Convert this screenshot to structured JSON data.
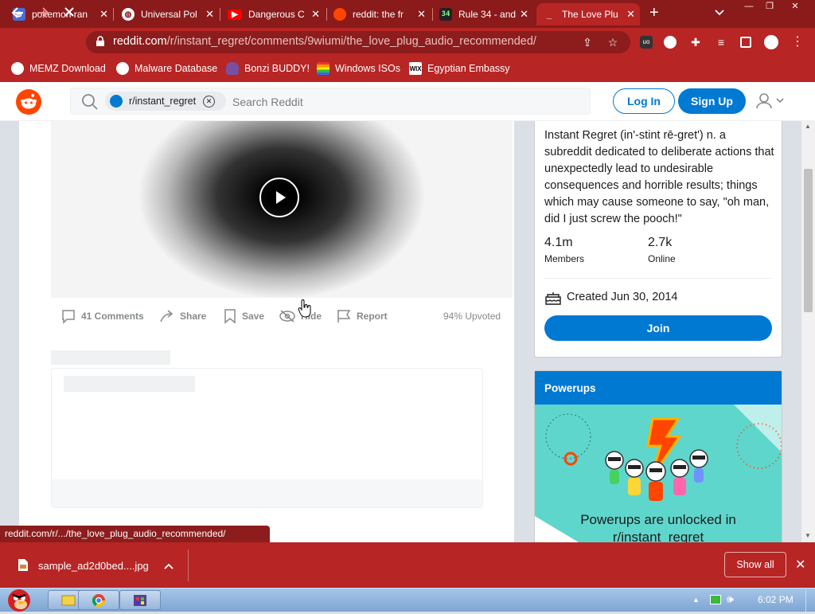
{
  "tabs": [
    {
      "label": "pokemon ran",
      "icon": "globe-icon"
    },
    {
      "label": "Universal Pol",
      "icon": "globe-icon"
    },
    {
      "label": "Dangerous C",
      "icon": "youtube-icon"
    },
    {
      "label": "reddit: the fr",
      "icon": "reddit-icon"
    },
    {
      "label": "Rule 34 - and",
      "icon": "r34-icon"
    },
    {
      "label": "The Love Plu",
      "icon": "loading-icon"
    }
  ],
  "address": {
    "domain": "reddit.com",
    "path": "/r/instant_regret/comments/9wiumi/the_love_plug_audio_recommended/"
  },
  "bookmarks": [
    {
      "label": "MEMZ Download"
    },
    {
      "label": "Malware Database"
    },
    {
      "label": "Bonzi BUDDY!"
    },
    {
      "label": "Windows ISOs"
    },
    {
      "label": "Egyptian Embassy"
    }
  ],
  "header": {
    "chip_label": "r/instant_regret",
    "search_placeholder": "Search Reddit",
    "login_label": "Log In",
    "signup_label": "Sign Up"
  },
  "post": {
    "actions": {
      "comments": "41 Comments",
      "share": "Share",
      "save": "Save",
      "hide": "Hide",
      "report": "Report"
    },
    "upvoted": "94% Upvoted"
  },
  "sidebar": {
    "description": "Instant Regret (in'-stint rē-gret') n. a subreddit dedicated to deliberate actions that unexpectedly lead to undesirable consequences and horrible results; things which may cause someone to say, \"oh man, did I just screw the pooch!\"",
    "members_value": "4.1m",
    "members_label": "Members",
    "online_value": "2.7k",
    "online_label": "Online",
    "created": "Created Jun 30, 2014",
    "join_label": "Join",
    "powerups_title": "Powerups",
    "powerups_text": "Powerups are unlocked in r/instant_regret"
  },
  "status_url": "reddit.com/r/.../the_love_plug_audio_recommended/",
  "download": {
    "filename": "sample_ad2d0bed....jpg",
    "show_all": "Show all"
  },
  "taskbar": {
    "time": "6:02 PM"
  },
  "colors": {
    "browser_frame": "#b72525",
    "reddit_blue": "#0079d3",
    "reddit_orange": "#ff4500"
  }
}
